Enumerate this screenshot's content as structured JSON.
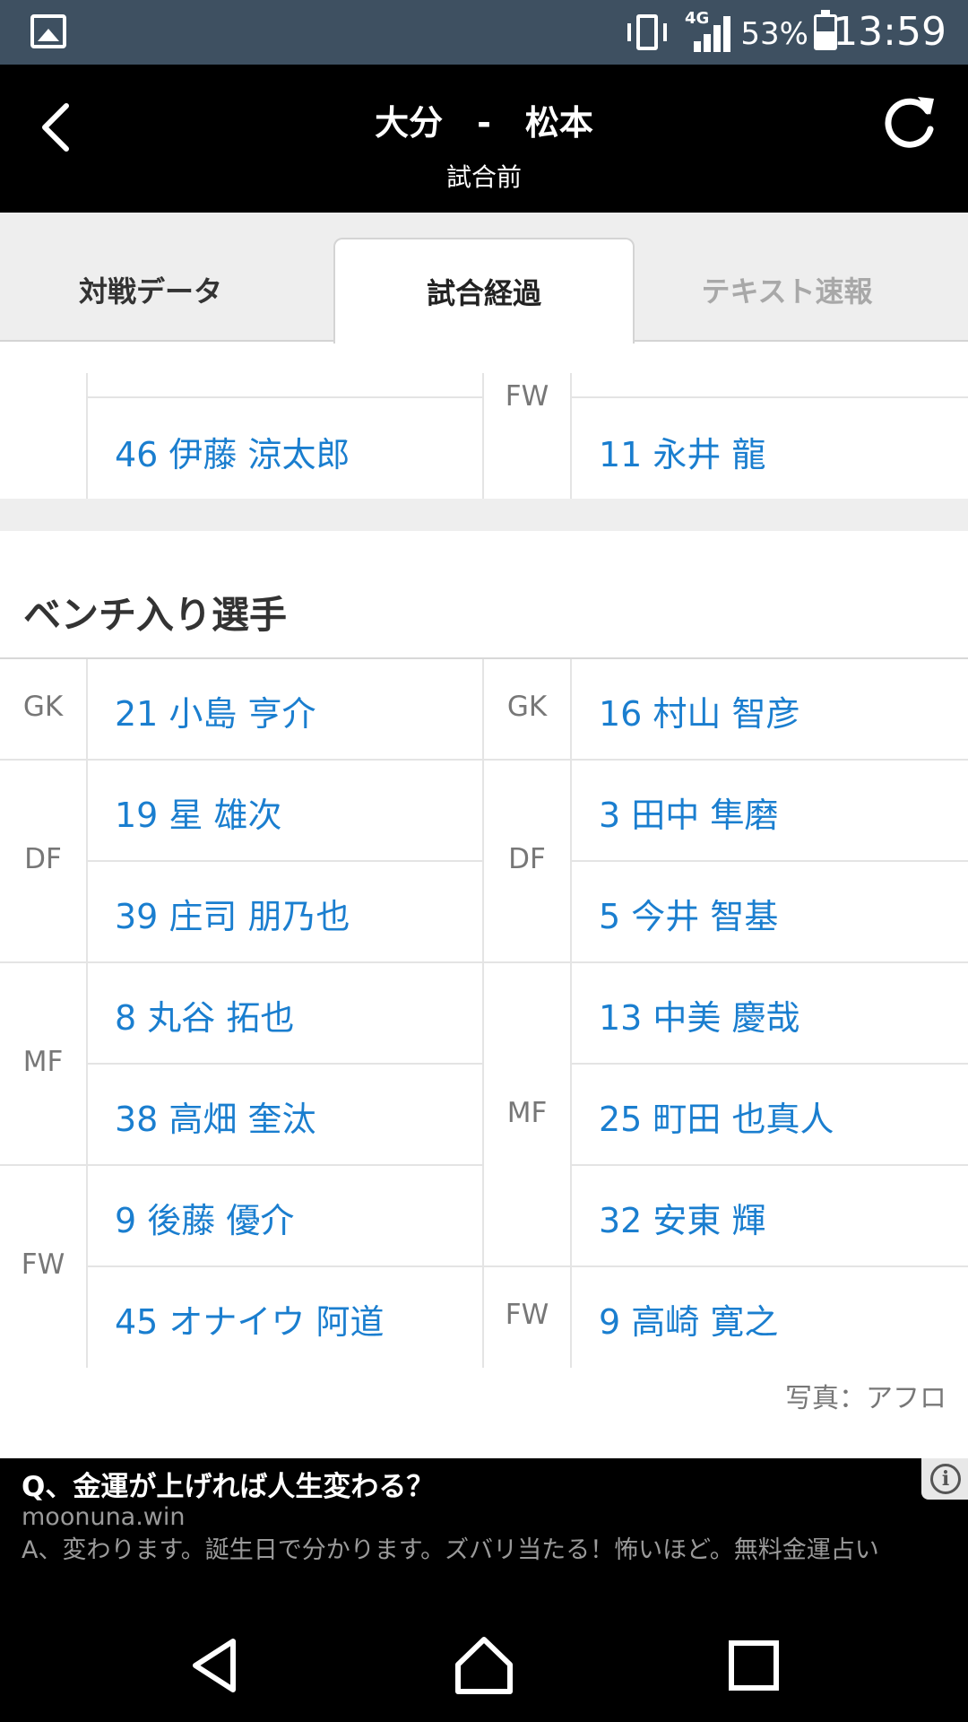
{
  "status_bar": {
    "battery_percent": "53%",
    "time": "13:59",
    "network": "4G"
  },
  "header": {
    "title": "大分　-　松本",
    "subtitle": "試合前"
  },
  "tabs": [
    "対戦データ",
    "試合経過",
    "テキスト速報"
  ],
  "lineup_partial": {
    "left": {
      "player": "46 伊藤 涼太郎"
    },
    "right": {
      "position": "FW",
      "player": "11 永井 龍"
    }
  },
  "bench": {
    "title": "ベンチ入り選手",
    "left": {
      "gk": {
        "position": "GK",
        "players": [
          "21 小島 亨介"
        ]
      },
      "df": {
        "position": "DF",
        "players": [
          "19 星 雄次",
          "39 庄司 朋乃也"
        ]
      },
      "mf": {
        "position": "MF",
        "players": [
          "8 丸谷 拓也",
          "38 高畑 奎汰"
        ]
      },
      "fw": {
        "position": "FW",
        "players": [
          "9 後藤 優介",
          "45 オナイウ 阿道"
        ]
      }
    },
    "right": {
      "gk": {
        "position": "GK",
        "players": [
          "16 村山 智彦"
        ]
      },
      "df": {
        "position": "DF",
        "players": [
          "3 田中 隼磨",
          "5 今井 智基"
        ]
      },
      "mf": {
        "position": "MF",
        "players": [
          "13 中美 慶哉",
          "25 町田 也真人",
          "32 安東 輝"
        ]
      },
      "fw": {
        "position": "FW",
        "players": [
          "9 高崎 寛之"
        ]
      }
    }
  },
  "photo_credit": "写真：アフロ",
  "ad": {
    "title": "Q、金運が上げれば人生変わる？",
    "url": "moonuna.win",
    "body": "A、変わります。誕生日で分かります。ズバリ当たる！怖いほど。無料金運占い"
  }
}
